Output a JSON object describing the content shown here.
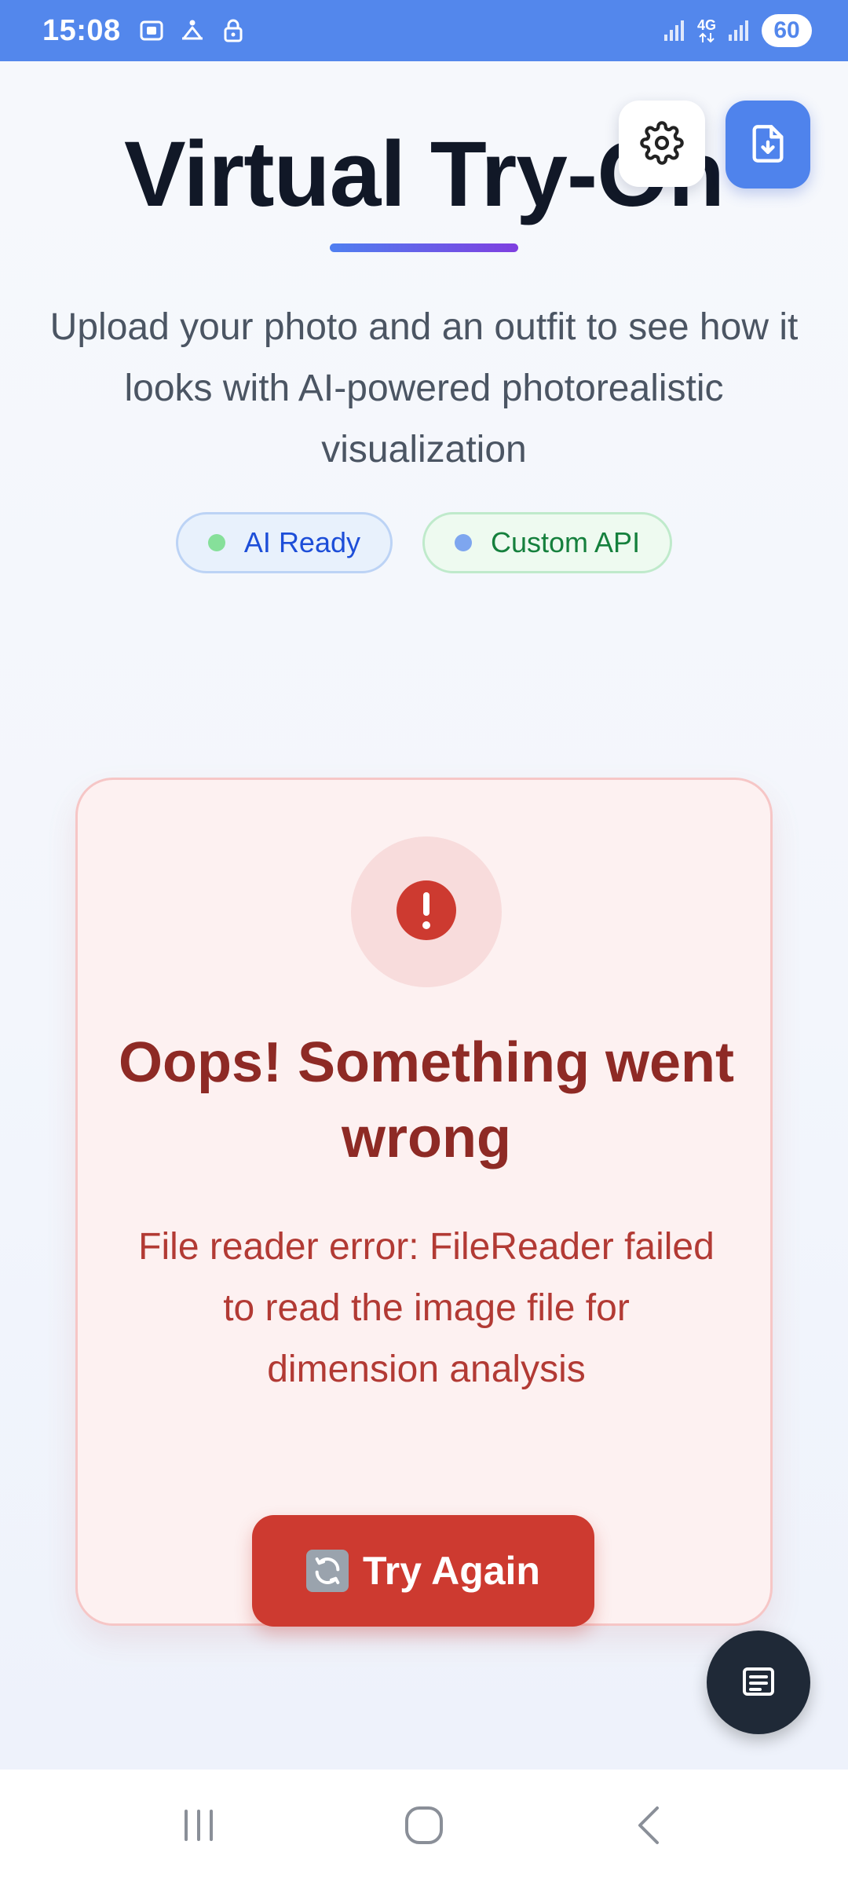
{
  "status_bar": {
    "time": "15:08",
    "network_label": "4G",
    "battery": "60",
    "icons": [
      "screenshot-icon",
      "accessibility-icon",
      "lock-icon",
      "signal-icon",
      "signal-4g-icon",
      "signal-icon"
    ]
  },
  "header": {
    "title": "Virtual Try-On",
    "subtitle": "Upload your photo and an outfit to see how it looks with AI-powered photorealistic visualization",
    "badges": [
      {
        "label": "AI Ready",
        "dot_color": "#86e09a"
      },
      {
        "label": "Custom API",
        "dot_color": "#7ea6ef"
      }
    ],
    "actions": [
      "settings-icon",
      "download-file-icon"
    ]
  },
  "error": {
    "heading": "Oops! Something went wrong",
    "message": "File reader error: FileReader failed to read the image file for dimension analysis",
    "retry_icon": "🔄",
    "retry_label": "Try Again"
  },
  "floating": {
    "notes_icon": "notes-icon"
  },
  "colors": {
    "status_bar": "#5387ec",
    "primary": "#4f83ec",
    "error_text": "#8e2a25",
    "error_button": "#cd3a30",
    "fab_dark": "#1f2937"
  }
}
